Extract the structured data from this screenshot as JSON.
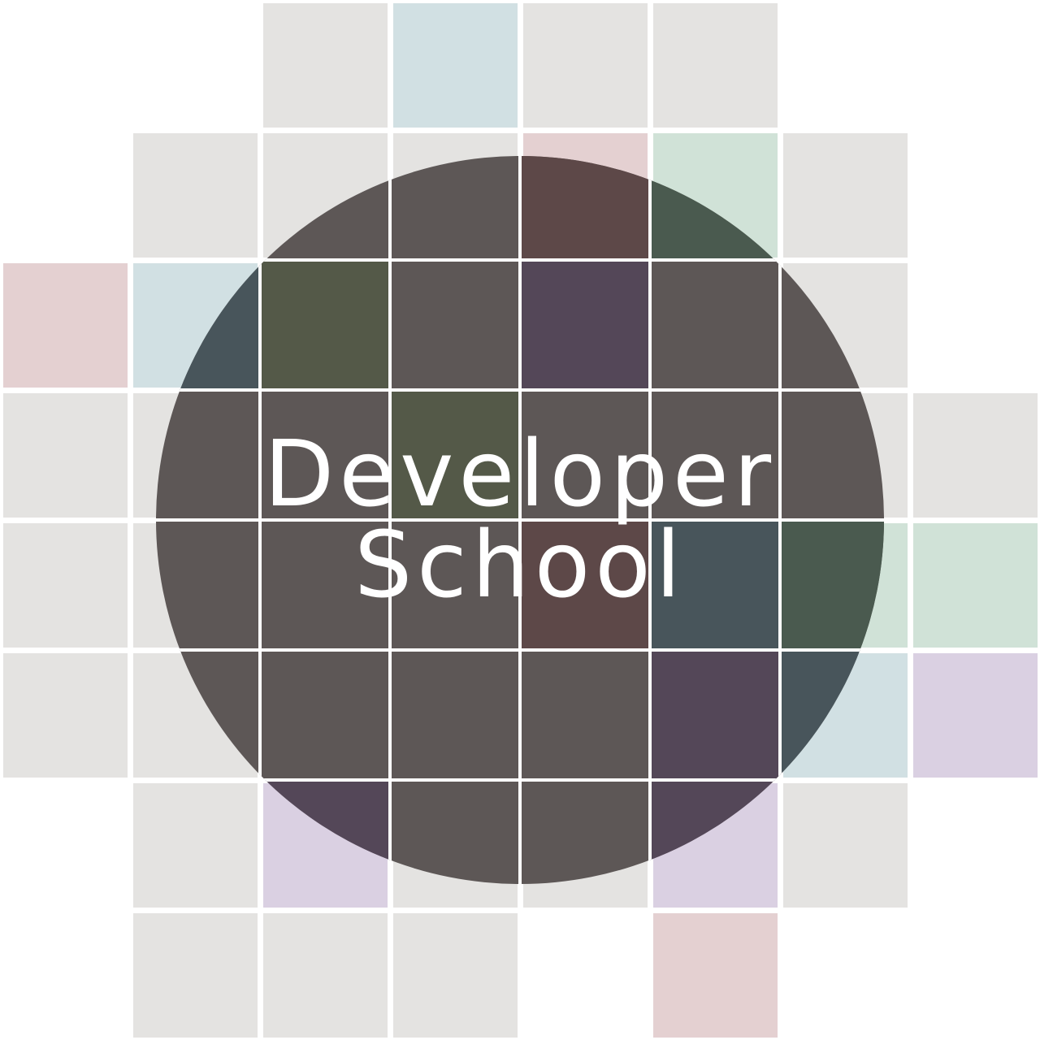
{
  "title": {
    "line1": "Developer",
    "line2": "School"
  },
  "colors": {
    "background": "#ffffff",
    "circle": "#5d5756",
    "text": "#ffffff",
    "tile_gray": "#e4e3e1",
    "tile_blue": "#d1e0e3",
    "tile_pink": "#e4d0d1",
    "tile_green": "#d0e2d7",
    "tile_purple": "#dad0e2",
    "circle_olive": "#545948",
    "circle_purple": "#544758",
    "circle_maroon": "#5d4848",
    "circle_green": "#4a5a4f",
    "circle_slate": "#48555b"
  }
}
